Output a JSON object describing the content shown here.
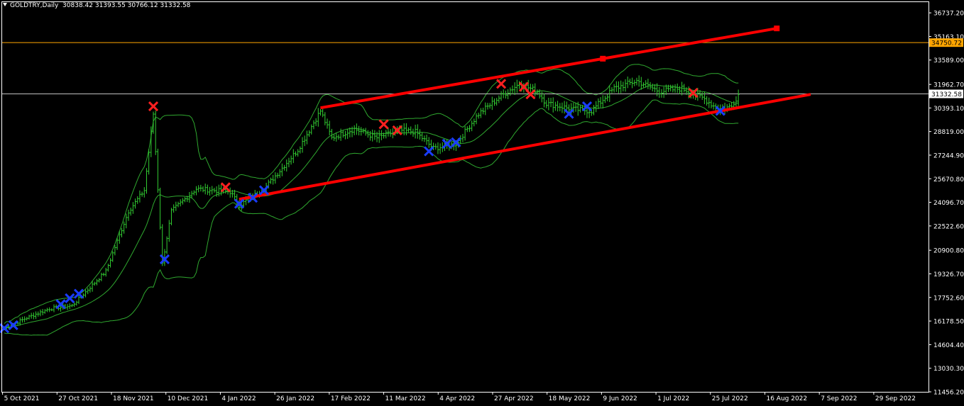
{
  "header": {
    "symbol": "GOLDTRY,Daily",
    "ohlc": "30838.42 31393.55 30766.12 31332.58"
  },
  "chart_data": {
    "type": "bar",
    "price_scale": {
      "ticks": [
        "36737.20",
        "35163.10",
        "33589.00",
        "31962.70",
        "30393.10",
        "28819.00",
        "27244.90",
        "25670.80",
        "24096.70",
        "22522.60",
        "20900.80",
        "19326.70",
        "17752.60",
        "16178.50",
        "14604.40",
        "13030.30",
        "11456.20"
      ],
      "ylim": [
        11456.2,
        37500
      ]
    },
    "time_axis": {
      "labels": [
        "5 Oct 2021",
        "27 Oct 2021",
        "18 Nov 2021",
        "10 Dec 2021",
        "4 Jan 2022",
        "26 Jan 2022",
        "17 Feb 2022",
        "11 Mar 2022",
        "4 Apr 2022",
        "27 Apr 2022",
        "18 May 2022",
        "9 Jun 2022",
        "1 Jul 2022",
        "25 Jul 2022",
        "16 Aug 2022",
        "7 Sep 2022",
        "29 Sep 2022"
      ]
    },
    "horizontal_lines": [
      {
        "price": 34750.72,
        "label": "34750.72",
        "color": "#ffa500"
      },
      {
        "price": 31332.58,
        "label": "31332.58",
        "color": "#c0c0c0"
      }
    ],
    "price_anchors": [
      [
        0,
        15700
      ],
      [
        10,
        16400
      ],
      [
        20,
        17000
      ],
      [
        30,
        17200
      ],
      [
        45,
        19500
      ],
      [
        55,
        23500
      ],
      [
        62,
        24900
      ],
      [
        66,
        30000
      ],
      [
        70,
        20000
      ],
      [
        74,
        23500
      ],
      [
        85,
        25000
      ],
      [
        100,
        24800
      ],
      [
        104,
        23900
      ],
      [
        115,
        25000
      ],
      [
        130,
        27600
      ],
      [
        140,
        30200
      ],
      [
        145,
        28400
      ],
      [
        155,
        29000
      ],
      [
        165,
        28400
      ],
      [
        175,
        28900
      ],
      [
        182,
        28800
      ],
      [
        190,
        27700
      ],
      [
        200,
        28000
      ],
      [
        210,
        30000
      ],
      [
        220,
        31200
      ],
      [
        228,
        32000
      ],
      [
        236,
        31500
      ],
      [
        240,
        30700
      ],
      [
        252,
        30300
      ],
      [
        260,
        30200
      ],
      [
        270,
        31700
      ],
      [
        280,
        32200
      ],
      [
        290,
        31500
      ],
      [
        300,
        31700
      ],
      [
        310,
        31000
      ],
      [
        316,
        30300
      ],
      [
        322,
        30500
      ],
      [
        325,
        31300
      ]
    ],
    "channel_upper": {
      "from": [
        140,
        30400
      ],
      "to": [
        342,
        35700
      ]
    },
    "channel_lower": {
      "from": [
        104,
        24300
      ],
      "to": [
        357,
        31300
      ]
    },
    "channel_color": "#ff0000",
    "bands_color": "#2fa82f",
    "bar_color": "#32cd32",
    "sell_signal_color": "#ff2020",
    "buy_signal_color": "#1a3cff",
    "sell_signals": [
      [
        66,
        30500
      ],
      [
        98,
        25100
      ],
      [
        168,
        29300
      ],
      [
        174,
        28900
      ],
      [
        220,
        32000
      ],
      [
        230,
        31800
      ],
      [
        233,
        31300
      ],
      [
        305,
        31400
      ]
    ],
    "buy_signals": [
      [
        0,
        15700
      ],
      [
        4,
        15900
      ],
      [
        25,
        17300
      ],
      [
        29,
        17700
      ],
      [
        33,
        18000
      ],
      [
        71,
        20300
      ],
      [
        104,
        24000
      ],
      [
        110,
        24400
      ],
      [
        115,
        24900
      ],
      [
        188,
        27500
      ],
      [
        196,
        28000
      ],
      [
        200,
        28100
      ],
      [
        250,
        30000
      ],
      [
        258,
        30500
      ],
      [
        317,
        30200
      ]
    ]
  }
}
